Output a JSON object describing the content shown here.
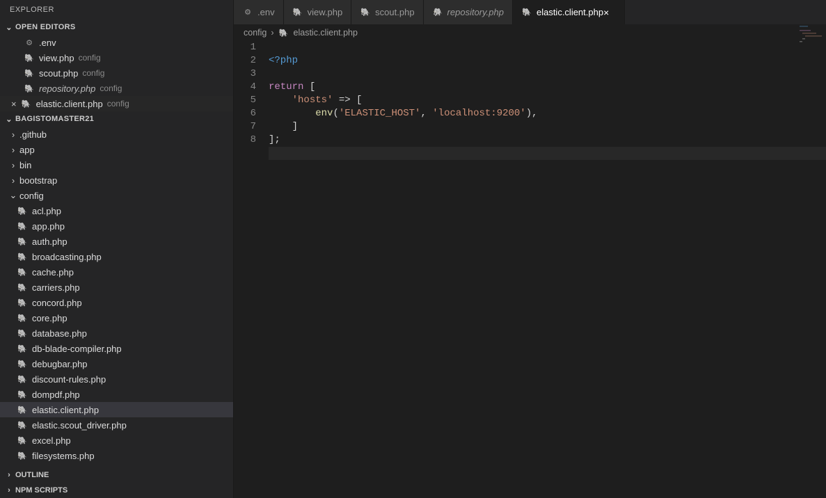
{
  "sidebar": {
    "title": "EXPLORER",
    "open_editors_label": "OPEN EDITORS",
    "open_editors": [
      {
        "name": ".env",
        "icon": "gear",
        "hint": ""
      },
      {
        "name": "view.php",
        "icon": "php",
        "hint": "config"
      },
      {
        "name": "scout.php",
        "icon": "php",
        "hint": "config"
      },
      {
        "name": "repository.php",
        "icon": "php",
        "hint": "config",
        "italic": true
      },
      {
        "name": "elastic.client.php",
        "icon": "php",
        "hint": "config",
        "dirty": true
      }
    ],
    "project_label": "BAGISTOMASTER21",
    "tree": [
      {
        "name": ".github",
        "type": "dir"
      },
      {
        "name": "app",
        "type": "dir"
      },
      {
        "name": "bin",
        "type": "dir"
      },
      {
        "name": "bootstrap",
        "type": "dir"
      },
      {
        "name": "config",
        "type": "dir",
        "open": true
      },
      {
        "name": "acl.php",
        "type": "file"
      },
      {
        "name": "app.php",
        "type": "file"
      },
      {
        "name": "auth.php",
        "type": "file"
      },
      {
        "name": "broadcasting.php",
        "type": "file"
      },
      {
        "name": "cache.php",
        "type": "file"
      },
      {
        "name": "carriers.php",
        "type": "file"
      },
      {
        "name": "concord.php",
        "type": "file"
      },
      {
        "name": "core.php",
        "type": "file"
      },
      {
        "name": "database.php",
        "type": "file"
      },
      {
        "name": "db-blade-compiler.php",
        "type": "file"
      },
      {
        "name": "debugbar.php",
        "type": "file"
      },
      {
        "name": "discount-rules.php",
        "type": "file"
      },
      {
        "name": "dompdf.php",
        "type": "file"
      },
      {
        "name": "elastic.client.php",
        "type": "file",
        "active": true
      },
      {
        "name": "elastic.scout_driver.php",
        "type": "file"
      },
      {
        "name": "excel.php",
        "type": "file"
      },
      {
        "name": "filesystems.php",
        "type": "file"
      }
    ],
    "outline_label": "OUTLINE",
    "npm_label": "NPM SCRIPTS"
  },
  "tabs": [
    {
      "name": ".env",
      "icon": "gear"
    },
    {
      "name": "view.php",
      "icon": "php"
    },
    {
      "name": "scout.php",
      "icon": "php"
    },
    {
      "name": "repository.php",
      "icon": "php",
      "italic": true
    },
    {
      "name": "elastic.client.php",
      "icon": "php",
      "active": true,
      "close": "×"
    }
  ],
  "breadcrumb": {
    "seg0": "config",
    "sep": "›",
    "seg1": "elastic.client.php",
    "icon": "php"
  },
  "editor": {
    "lines": [
      "1",
      "2",
      "3",
      "4",
      "5",
      "6",
      "7",
      "8"
    ],
    "code_tokens": {
      "l1": "<?php",
      "l3_return": "return",
      "l3_rest": " [",
      "l4_key": "'hosts'",
      "l4_arrow": " => [",
      "l5_fn": "env",
      "l5_arg1": "'ELASTIC_HOST'",
      "l5_comma": ", ",
      "l5_arg2": "'localhost:9200'",
      "l5_close": "),",
      "l6": "    ]",
      "l7": "];"
    }
  }
}
